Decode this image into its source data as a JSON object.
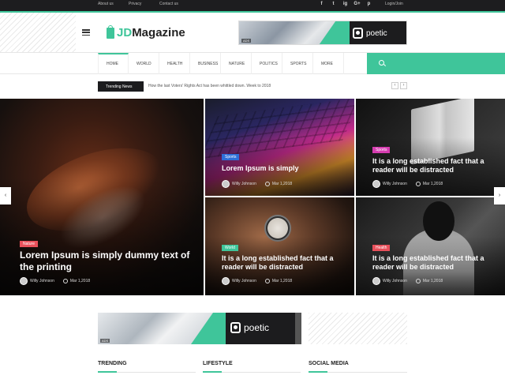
{
  "topbar": {
    "links": [
      "About us",
      "Privacy",
      "Contact us"
    ],
    "social": [
      "f",
      "t",
      "ig",
      "G+",
      "p"
    ],
    "login": "Login/Join"
  },
  "header": {
    "logo_accent": "JD",
    "logo_main": "Magazine",
    "ad_brand": "poetic",
    "ad_tag": "ADS"
  },
  "nav": {
    "items": [
      "HOME",
      "WORLD",
      "HEALTH",
      "BUSINESS",
      "NATURE",
      "POLITICS",
      "SPORTS",
      "MORE"
    ]
  },
  "trending": {
    "label": "Trending News",
    "text": "How the last Voters' Rights Act has been whittled down. Week to 2018"
  },
  "grid": {
    "tiles": [
      {
        "category": "Nature",
        "category_color": "#e8505b",
        "title": "Lorem Ipsum is simply dummy text of the printing",
        "author": "Willy Johnson",
        "date": "Mar 1,2018"
      },
      {
        "category": "Sports",
        "category_color": "#2e6fd8",
        "title": "Lorem Ipsum is simply",
        "author": "Willy Johnson",
        "date": "Mar 1,2018"
      },
      {
        "category": "Sports",
        "category_color": "#d63cb0",
        "title": "It is a long established fact that a reader will be distracted",
        "author": "Willy Johnson",
        "date": "Mar 1,2018"
      },
      {
        "category": "World",
        "category_color": "#3fc59a",
        "title": "It is a long established fact that a reader will be distracted",
        "author": "Willy Johnson",
        "date": "Mar 1,2018"
      },
      {
        "category": "Health",
        "category_color": "#e8505b",
        "title": "It is a long established fact that a reader will be distracted",
        "author": "Willy Johnson",
        "date": "Mar 1,2018"
      }
    ],
    "prev_arrow": "‹",
    "next_arrow": "›"
  },
  "ad_bottom": {
    "brand": "poetic",
    "tag": "ADS"
  },
  "sections": [
    "TRENDING",
    "LIFESTYLE",
    "SOCIAL MEDIA"
  ],
  "colors": {
    "accent": "#3fc59a",
    "dark": "#1c1c1e"
  }
}
